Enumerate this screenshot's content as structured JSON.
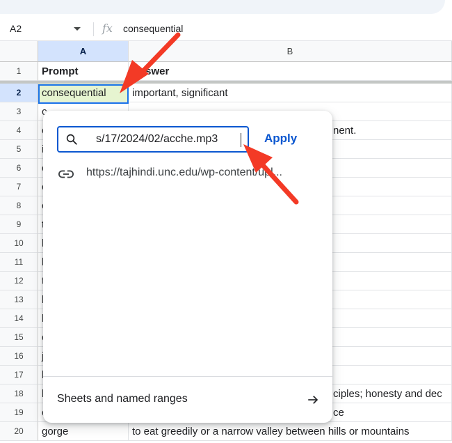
{
  "formula_bar": {
    "cell_ref": "A2",
    "fx_label": "fx",
    "value": "consequential"
  },
  "columns": [
    "A",
    "B"
  ],
  "rows": [
    {
      "num": "1",
      "a": "Prompt",
      "b": "nswer"
    },
    {
      "num": "2",
      "a": "consequential",
      "b": "important, significant"
    },
    {
      "num": "3",
      "a": "c",
      "b": ""
    },
    {
      "num": "4",
      "a": "c",
      "b": "nent."
    },
    {
      "num": "5",
      "a": "i",
      "b": ""
    },
    {
      "num": "6",
      "a": "c",
      "b": ""
    },
    {
      "num": "7",
      "a": "c",
      "b": ""
    },
    {
      "num": "8",
      "a": "c",
      "b": ""
    },
    {
      "num": "9",
      "a": "t",
      "b": ""
    },
    {
      "num": "10",
      "a": "l",
      "b": ""
    },
    {
      "num": "11",
      "a": "l",
      "b": ""
    },
    {
      "num": "12",
      "a": "t",
      "b": ""
    },
    {
      "num": "13",
      "a": "l",
      "b": ""
    },
    {
      "num": "14",
      "a": "l",
      "b": ""
    },
    {
      "num": "15",
      "a": "c",
      "b": ""
    },
    {
      "num": "16",
      "a": "j",
      "b": ""
    },
    {
      "num": "17",
      "a": "l",
      "b": ""
    },
    {
      "num": "18",
      "a": "l",
      "b": "ciples; honesty and dec"
    },
    {
      "num": "19",
      "a": "c",
      "b": "ce"
    },
    {
      "num": "20",
      "a": "gorge",
      "b": "to eat greedily or a narrow valley between hills or mountains"
    }
  ],
  "link_dialog": {
    "search_value": "s/17/2024/02/acche.mp3",
    "apply_label": "Apply",
    "suggestion_url": "https://tajhindi.unc.edu/wp-content/upl...",
    "sheets_label": "Sheets and named ranges",
    "search_icon": "search-icon",
    "link_icon": "link-icon",
    "arrow_icon": "arrow-right-icon"
  },
  "colors": {
    "accent": "#0b57d0",
    "selection_header": "#d3e3fd",
    "active_border": "#1a73e8",
    "annotation_arrow": "#f33a26"
  }
}
